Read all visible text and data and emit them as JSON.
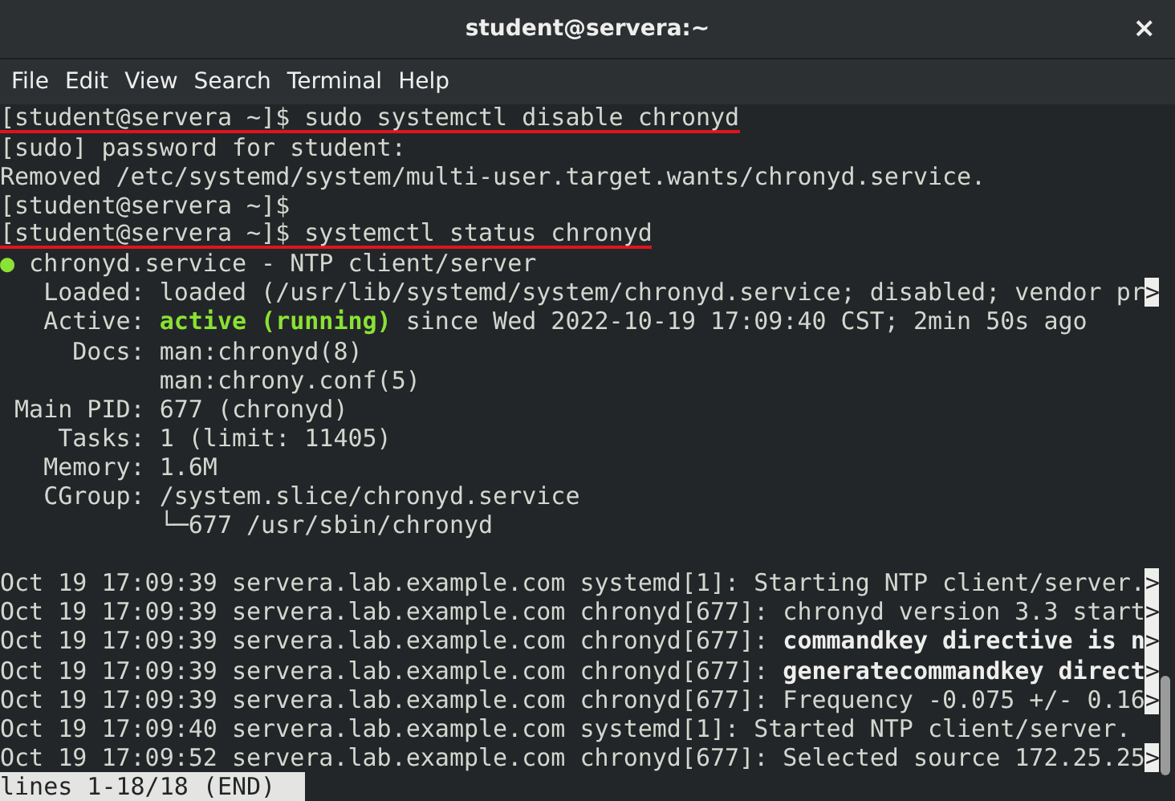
{
  "window": {
    "title": "student@servera:~",
    "close": "×"
  },
  "menu": [
    "File",
    "Edit",
    "View",
    "Search",
    "Terminal",
    "Help"
  ],
  "lines": [
    {
      "kind": "text",
      "underlined": true,
      "segments": [
        {
          "kind": "plain",
          "text": "[student@servera ~]$ sudo systemctl disable chronyd"
        }
      ]
    },
    {
      "kind": "text",
      "underlined": false,
      "segments": [
        {
          "kind": "plain",
          "text": "[sudo] password for student:"
        }
      ]
    },
    {
      "kind": "text",
      "underlined": false,
      "segments": [
        {
          "kind": "plain",
          "text": "Removed /etc/systemd/system/multi-user.target.wants/chronyd.service."
        }
      ]
    },
    {
      "kind": "text",
      "underlined": false,
      "segments": [
        {
          "kind": "plain",
          "text": "[student@servera ~]$"
        }
      ]
    },
    {
      "kind": "text",
      "underlined": true,
      "segments": [
        {
          "kind": "plain",
          "text": "[student@servera ~]$ systemctl status chronyd"
        }
      ]
    },
    {
      "kind": "text",
      "underlined": false,
      "segments": [
        {
          "kind": "status-dot",
          "text": "●"
        },
        {
          "kind": "plain",
          "text": " chronyd.service - NTP client/server"
        }
      ]
    },
    {
      "kind": "text",
      "underlined": false,
      "segments": [
        {
          "kind": "plain",
          "text": "   Loaded: loaded (/usr/lib/systemd/system/chronyd.service; disabled; vendor pr"
        }
      ],
      "marker": ">"
    },
    {
      "kind": "text",
      "underlined": false,
      "segments": [
        {
          "kind": "plain",
          "text": "   Active: "
        },
        {
          "kind": "highlight",
          "text": "active (running)"
        },
        {
          "kind": "plain",
          "text": " since Wed 2022-10-19 17:09:40 CST; 2min 50s ago"
        }
      ]
    },
    {
      "kind": "text",
      "underlined": false,
      "segments": [
        {
          "kind": "plain",
          "text": "     Docs: man:chronyd(8)"
        }
      ]
    },
    {
      "kind": "text",
      "underlined": false,
      "segments": [
        {
          "kind": "plain",
          "text": "           man:chrony.conf(5)"
        }
      ]
    },
    {
      "kind": "text",
      "underlined": false,
      "segments": [
        {
          "kind": "plain",
          "text": " Main PID: 677 (chronyd)"
        }
      ]
    },
    {
      "kind": "text",
      "underlined": false,
      "segments": [
        {
          "kind": "plain",
          "text": "    Tasks: 1 (limit: 11405)"
        }
      ]
    },
    {
      "kind": "text",
      "underlined": false,
      "segments": [
        {
          "kind": "plain",
          "text": "   Memory: 1.6M"
        }
      ]
    },
    {
      "kind": "text",
      "underlined": false,
      "segments": [
        {
          "kind": "plain",
          "text": "   CGroup: /system.slice/chronyd.service"
        }
      ]
    },
    {
      "kind": "text",
      "underlined": false,
      "segments": [
        {
          "kind": "plain",
          "text": "           └─677 /usr/sbin/chronyd"
        }
      ]
    },
    {
      "kind": "blank"
    },
    {
      "kind": "text",
      "underlined": false,
      "segments": [
        {
          "kind": "plain",
          "text": "Oct 19 17:09:39 servera.lab.example.com systemd[1]: Starting NTP client/server."
        }
      ],
      "marker": ">"
    },
    {
      "kind": "text",
      "underlined": false,
      "segments": [
        {
          "kind": "plain",
          "text": "Oct 19 17:09:39 servera.lab.example.com chronyd[677]: chronyd version 3.3 start"
        }
      ],
      "marker": ">"
    },
    {
      "kind": "text",
      "underlined": false,
      "segments": [
        {
          "kind": "plain",
          "text": "Oct 19 17:09:39 servera.lab.example.com chronyd[677]: "
        },
        {
          "kind": "bold",
          "text": "commandkey directive is n"
        }
      ],
      "marker": ">"
    },
    {
      "kind": "text",
      "underlined": false,
      "segments": [
        {
          "kind": "plain",
          "text": "Oct 19 17:09:39 servera.lab.example.com chronyd[677]: "
        },
        {
          "kind": "bold",
          "text": "generatecommandkey direct"
        }
      ],
      "marker": ">"
    },
    {
      "kind": "text",
      "underlined": false,
      "segments": [
        {
          "kind": "plain",
          "text": "Oct 19 17:09:39 servera.lab.example.com chronyd[677]: Frequency -0.075 +/- 0.16"
        }
      ],
      "marker": ">"
    },
    {
      "kind": "text",
      "underlined": false,
      "segments": [
        {
          "kind": "plain",
          "text": "Oct 19 17:09:40 servera.lab.example.com systemd[1]: Started NTP client/server."
        }
      ]
    },
    {
      "kind": "text",
      "underlined": false,
      "segments": [
        {
          "kind": "plain",
          "text": "Oct 19 17:09:52 servera.lab.example.com chronyd[677]: Selected source 172.25.25"
        }
      ],
      "marker": ">"
    },
    {
      "kind": "status",
      "text": "lines 1-18/18 (END)"
    }
  ]
}
